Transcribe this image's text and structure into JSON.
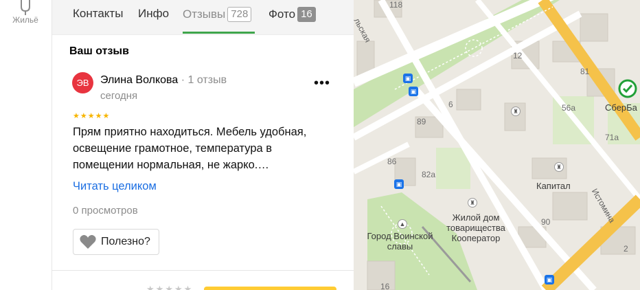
{
  "rail": {
    "housing_label": "Жильё"
  },
  "tabs": [
    {
      "label": "Контакты"
    },
    {
      "label": "Инфо"
    },
    {
      "label": "Отзывы",
      "count": "728"
    },
    {
      "label": "Фото",
      "count": "16"
    }
  ],
  "review_section": {
    "title": "Ваш отзыв",
    "author": {
      "initials": "ЭВ",
      "name": "Элина Волкова",
      "reviews_count": "1 отзыв",
      "date": "сегодня"
    },
    "more_label": "•••",
    "rating": 5,
    "text": "Прям приятно находиться. Мебель удобная, освещение грамотное, температура в помещении нормальная, не жарко.…",
    "read_more": "Читать целиком",
    "views": "0 просмотров",
    "helpful_label": "Полезно?"
  },
  "map": {
    "labels": {
      "n118": "118",
      "n12": "12",
      "n81": "81",
      "n6": "6",
      "n56a": "56а",
      "n89": "89",
      "n71a": "71а",
      "n86": "86",
      "n82a": "82а",
      "n90": "90",
      "n16": "16",
      "n2": "2",
      "sberbank": "СберБа",
      "kapital": "Капитал",
      "housing_coop": "Жилой дом товарищества Кооператор",
      "city_glory": "Город Воинской славы",
      "street_istomina": "Истомина",
      "street_top": "льская"
    }
  },
  "colors": {
    "accent_green": "#3ea54b",
    "link_blue": "#1b6ee2",
    "avatar_red": "#e8343f",
    "star_yellow": "#f7b500"
  }
}
